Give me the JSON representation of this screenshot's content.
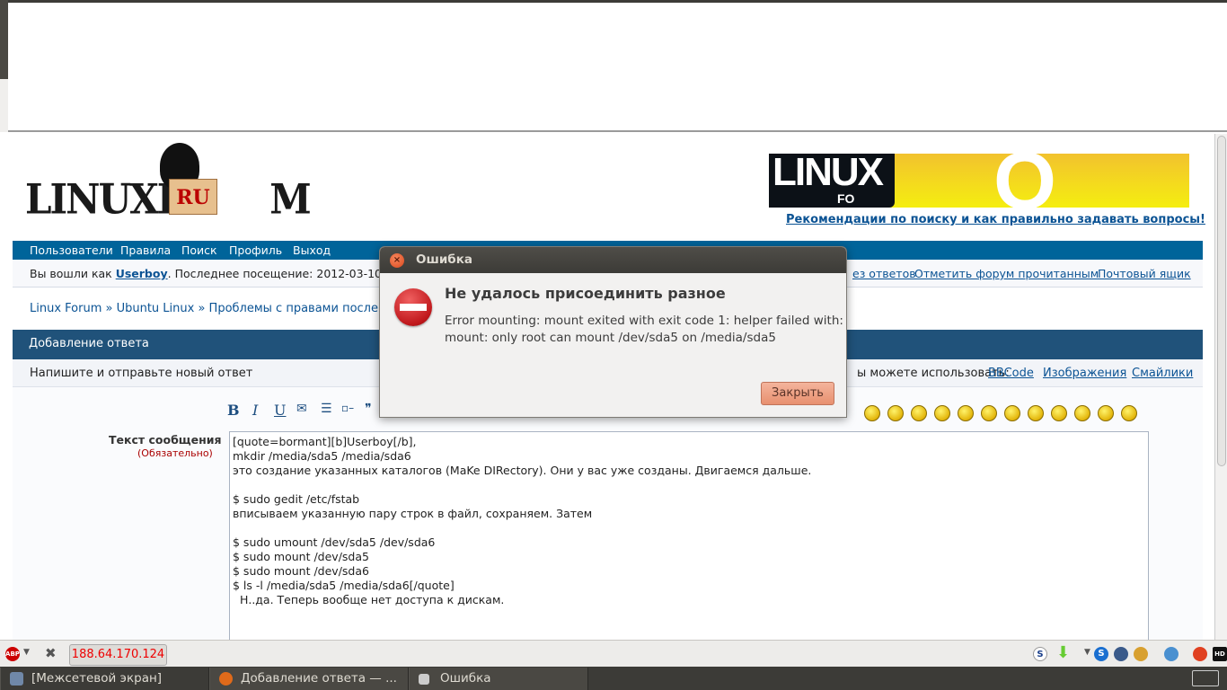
{
  "logo": {
    "text": "LINUXFORUM",
    "badge": "RU"
  },
  "banner": {
    "text": "LINUX FO",
    "link": "Рекомендации по поиску и как правильно задавать вопросы!"
  },
  "nav": [
    "Пользователи",
    "Правила",
    "Поиск",
    "Профиль",
    "Выход"
  ],
  "info": {
    "prefix": "Вы вошли как ",
    "user": "Userboy",
    "suffix": ". Последнее посещение: 2012-03-10 1",
    "links": [
      "ез ответов",
      "Отметить форум прочитанным",
      "Почтовый ящик"
    ]
  },
  "breadcrumb": "Linux Forum » Ubuntu Linux » Проблемы с правами после",
  "section_title": "Добавление ответа",
  "subheader": {
    "text": "Напишите и отправьте новый ответ",
    "allowed": "ы можете использовать: ",
    "links": [
      "BBCode",
      "Изображения",
      "Смайлики"
    ]
  },
  "toolbar": {
    "bold": "B",
    "italic": "I",
    "underline": "U"
  },
  "form": {
    "label": "Текст сообщения",
    "required": "(Обязательно)",
    "lines": [
      "[quote=bormant][b]Userboy[/b],",
      "mkdir /media/sda5 /media/sda6",
      "это создание указанных каталогов (MaKe DIRectory). Они у вас уже созданы. Двигаемся дальше.",
      "",
      "$ sudo gedit /etc/fstab",
      "вписываем указанную пару строк в файл, сохраняем. Затем",
      "",
      "$ sudo umount /dev/sda5 /dev/sda6",
      "$ sudo mount /dev/sda5",
      "$ sudo mount /dev/sda6",
      "$ ls -l /media/sda5 /media/sda6[/quote]",
      "  Н..да. Теперь вообще нет доступа к дискам."
    ]
  },
  "dialog": {
    "title": "Ошибка",
    "heading": "Не удалось присоединить разное",
    "message1": "Error mounting: mount exited with exit code 1: helper failed with:",
    "message2": "mount: only root can mount /dev/sda5 on /media/sda5",
    "button": "Закрыть"
  },
  "status": {
    "ip": "188.64.170.124"
  },
  "taskbar": [
    "[Межсетевой экран]",
    "Добавление ответа — ...",
    "Ошибка"
  ]
}
